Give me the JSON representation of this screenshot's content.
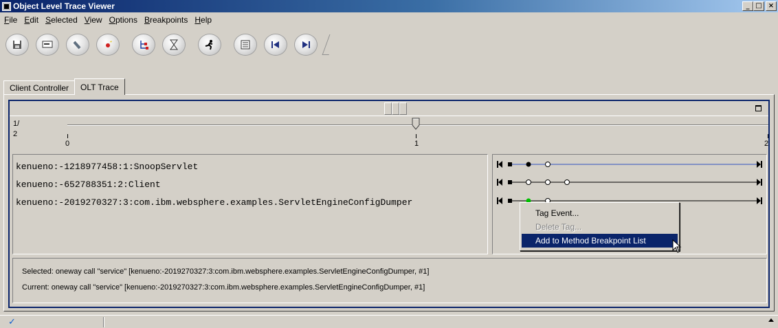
{
  "window": {
    "title": "Object Level Trace Viewer"
  },
  "menubar": [
    {
      "label": "File",
      "accel": "F"
    },
    {
      "label": "Edit",
      "accel": "E"
    },
    {
      "label": "Selected",
      "accel": "S"
    },
    {
      "label": "View",
      "accel": "V"
    },
    {
      "label": "Options",
      "accel": "O"
    },
    {
      "label": "Breakpoints",
      "accel": "B"
    },
    {
      "label": "Help",
      "accel": "H"
    }
  ],
  "toolbar": {
    "icons": [
      "save-icon",
      "monitor-icon",
      "wrench-icon",
      "pointer-icon",
      "tree-icon",
      "hourglass-icon",
      "runner-icon",
      "list-icon",
      "first-icon",
      "last-icon"
    ]
  },
  "tabs": [
    "Client Controller",
    "OLT Trace"
  ],
  "slider": {
    "ratio_numerator": "1/",
    "ratio_denominator": "2",
    "ticks": [
      "0",
      "1",
      "2"
    ],
    "min": 0,
    "max": 2,
    "value": 1
  },
  "trace_entries": [
    "kenueno:-1218977458:1:SnoopServlet",
    "kenueno:-652788351:2:Client",
    "kenueno:-2019270327:3:com.ibm.websphere.examples.ServletEngineConfigDumper"
  ],
  "context_menu": {
    "items": [
      {
        "label": "Tag Event...",
        "state": "normal"
      },
      {
        "label": "Delete Tag...",
        "state": "disabled"
      },
      {
        "label": "Add to Method Breakpoint List",
        "state": "highlighted"
      }
    ]
  },
  "status": {
    "selected": "Selected:  oneway call \"service\" [kenueno:-2019270327:3:com.ibm.websphere.examples.ServletEngineConfigDumper, #1]",
    "current": "Current:  oneway call \"service\" [kenueno:-2019270327:3:com.ibm.websphere.examples.ServletEngineConfigDumper, #1]"
  },
  "colors": {
    "titlebar_start": "#0a246a",
    "titlebar_end": "#a6caf0",
    "highlight": "#0a246a",
    "lane_line_selected": "#3050c0",
    "event_green": "#00c000"
  }
}
